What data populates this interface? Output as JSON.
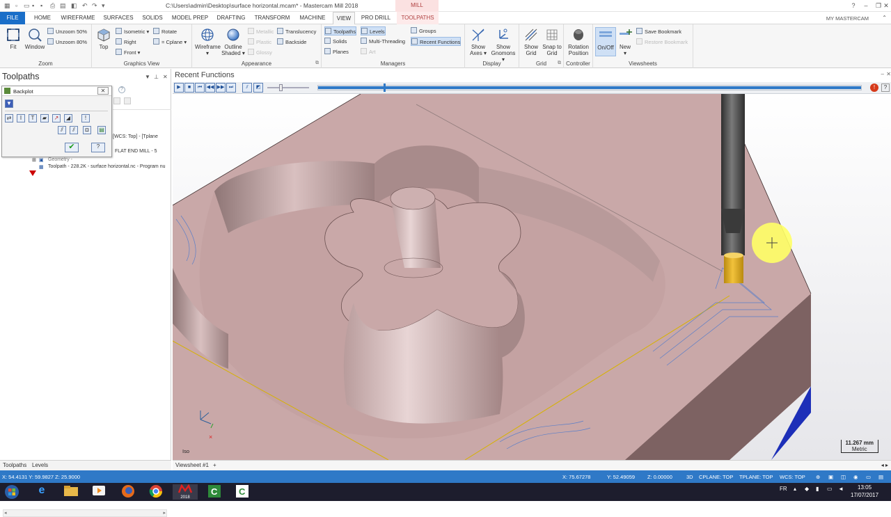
{
  "titlebar": {
    "path": "C:\\Users\\admin\\Desktop\\surface horizontal.mcam* - Mastercam Mill 2018",
    "context_tab": "MILL",
    "user": "MY MASTERCAM"
  },
  "menu": {
    "items": [
      "FILE",
      "HOME",
      "WIREFRAME",
      "SURFACES",
      "SOLIDS",
      "MODEL PREP",
      "DRAFTING",
      "TRANSFORM",
      "MACHINE",
      "VIEW",
      "PRO DRILL",
      "TOOLPATHS"
    ],
    "active": "VIEW"
  },
  "ribbon": {
    "zoom": {
      "label": "Zoom",
      "fit": "Fit",
      "window": "Window",
      "unzoom50": "Unzoom 50%",
      "unzoom80": "Unzoom 80%"
    },
    "graphics_view": {
      "label": "Graphics View",
      "top": "Top",
      "isometric": "Isometric",
      "right": "Right",
      "front": "Front",
      "rotate": "Rotate",
      "cplane": "= Cplane"
    },
    "appearance": {
      "label": "Appearance",
      "wireframe": "Wireframe",
      "outline_shaded": "Outline Shaded",
      "metallic": "Metallic",
      "plastic": "Plastic",
      "glossy": "Glossy",
      "translucency": "Translucency",
      "backside": "Backside"
    },
    "managers": {
      "label": "Managers",
      "toolpaths": "Toolpaths",
      "solids": "Solids",
      "planes": "Planes",
      "levels": "Levels",
      "multithreading": "Multi-Threading",
      "art": "Art",
      "groups": "Groups",
      "recent_functions": "Recent Functions"
    },
    "display": {
      "label": "Display",
      "show_axes": "Show Axes",
      "show_gnomons": "Show Gnomons"
    },
    "grid": {
      "label": "Grid",
      "show_grid": "Show Grid",
      "snap_to_grid": "Snap to Grid"
    },
    "controller": {
      "label": "Controller",
      "rotation_position": "Rotation Position"
    },
    "viewsheets": {
      "label": "Viewsheets",
      "onoff": "On/Off",
      "new": "New",
      "save_bookmark": "Save Bookmark",
      "restore_bookmark": "Restore Bookmark"
    }
  },
  "left_panel": {
    "title": "Toolpaths",
    "backplot_title": "Backplot",
    "tree": {
      "wcs_line": "[WCS: Top] - [Tplane",
      "tool_line": "FLAT END MILL - 5",
      "geometry": "Geometry -",
      "toolpath": "Toolpath - 228.2K - surface horizontal.nc - Program nu"
    },
    "tabs": [
      "Toolpaths",
      "Levels"
    ]
  },
  "viewport": {
    "header": "Recent Functions",
    "view_label": "Iso",
    "scale_value": "11.267 mm",
    "scale_unit": "Metric",
    "sheet_tab": "Viewsheet #1",
    "add_sheet": "+"
  },
  "status": {
    "left_coords": "X: 54.4131   Y: 59.9827   Z: 25.9000",
    "x": "X: 75.67278",
    "y": "Y: 52.49059",
    "z": "Z: 0.00000",
    "mode": "3D",
    "cplane": "CPLANE: TOP",
    "tplane": "TPLANE: TOP",
    "wcs": "WCS: TOP"
  },
  "taskbar": {
    "lang": "FR",
    "time": "13:05",
    "date": "17/07/2017",
    "mastercam_label": "2018"
  },
  "colors": {
    "accent": "#1a6ec8",
    "statusbar": "#2f79c7",
    "part": "#c9a8a8",
    "toolpath": "#5a7ec9",
    "tool_holder": "#4a4a4a",
    "cutter": "#d9a822",
    "cursor_highlight": "#ffff66"
  }
}
